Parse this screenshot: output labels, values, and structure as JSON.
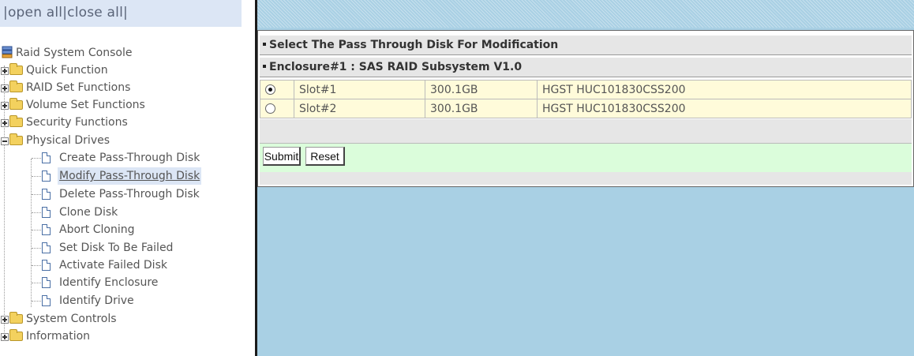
{
  "left": {
    "toolbar": {
      "open_all": "open all",
      "close_all": "close all",
      "sep": "|"
    },
    "root": "Raid System Console",
    "groups": [
      {
        "label": "Quick Function"
      },
      {
        "label": "RAID Set Functions"
      },
      {
        "label": "Volume Set Functions"
      },
      {
        "label": "Security Functions"
      },
      {
        "label": "Physical Drives",
        "children": [
          "Create Pass-Through Disk",
          "Modify Pass-Through Disk",
          "Delete Pass-Through Disk",
          "Clone Disk",
          "Abort Cloning",
          "Set Disk To Be Failed",
          "Activate Failed Disk",
          "Identify Enclosure",
          "Identify Drive"
        ]
      },
      {
        "label": "System Controls"
      },
      {
        "label": "Information"
      }
    ],
    "selected_item": "Modify Pass-Through Disk"
  },
  "main": {
    "section_title": "Select The Pass Through Disk For Modification",
    "enclosure_title": "Enclosure#1 : SAS RAID Subsystem V1.0",
    "drives": [
      {
        "selected": true,
        "slot": "Slot#1",
        "capacity": "300.1GB",
        "model": "HGST HUC101830CSS200"
      },
      {
        "selected": false,
        "slot": "Slot#2",
        "capacity": "300.1GB",
        "model": "HGST HUC101830CSS200"
      }
    ],
    "submit_label": "Submit",
    "reset_label": "Reset"
  },
  "colors": {
    "background_blue": "#a9d0e4",
    "row_yellow": "#fffbda",
    "button_row_green": "#dbfddb",
    "selection_blue": "#dce6f5"
  }
}
